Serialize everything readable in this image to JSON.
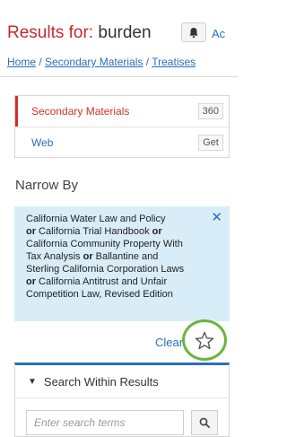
{
  "header": {
    "title_prefix": "Results for:",
    "query": "burden",
    "alert_icon": "bell-icon",
    "cut_link": "Ac"
  },
  "breadcrumb": {
    "items": [
      "Home",
      "Secondary Materials",
      "Treatises"
    ],
    "separator": "/"
  },
  "sources": [
    {
      "label": "Secondary Materials",
      "count": "360"
    },
    {
      "label": "Web",
      "count": "Get"
    }
  ],
  "narrow": {
    "heading": "Narrow By",
    "filter_lines": [
      [
        [
          "California Water Law and Policy",
          false
        ]
      ],
      [
        [
          "or",
          true
        ],
        [
          " California Trial Handbook ",
          false
        ],
        [
          "or",
          true
        ]
      ],
      [
        [
          "California Community Property With",
          false
        ]
      ],
      [
        [
          "Tax Analysis ",
          false
        ],
        [
          "or",
          true
        ],
        [
          " Ballantine and",
          false
        ]
      ],
      [
        [
          "Sterling California Corporation Laws",
          false
        ]
      ],
      [
        [
          "or",
          true
        ],
        [
          " California Antitrust and Unfair",
          false
        ]
      ],
      [
        [
          "Competition Law, Revised Edition",
          false
        ]
      ]
    ],
    "close_symbol": "✕",
    "clear_label": "Clear",
    "star_icon": "star-outline-icon"
  },
  "search_within": {
    "title": "Search Within Results",
    "placeholder": "Enter search terms",
    "button_icon": "search-icon"
  },
  "colors": {
    "brand_red": "#c9282d",
    "link_blue": "#2a6ebb",
    "filter_bg": "#d8edf8",
    "highlight_green": "#6cb33f"
  }
}
